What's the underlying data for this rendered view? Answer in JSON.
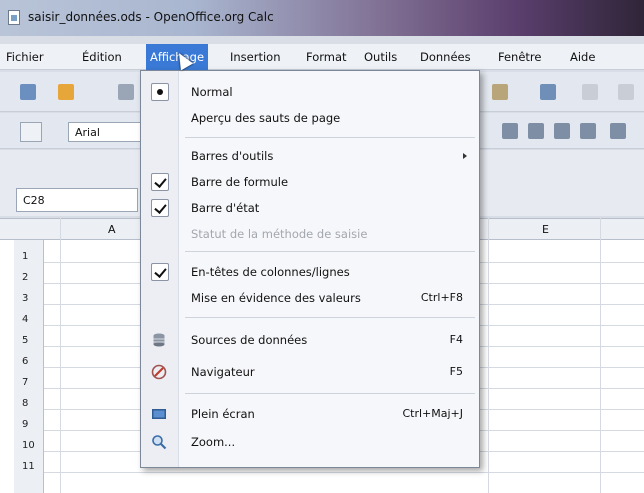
{
  "window": {
    "title": "saisir_données.ods - OpenOffice.org Calc"
  },
  "menubar": {
    "items": [
      {
        "label": "Fichier"
      },
      {
        "label": "Édition"
      },
      {
        "label": "Affichage"
      },
      {
        "label": "Insertion"
      },
      {
        "label": "Format"
      },
      {
        "label": "Outils"
      },
      {
        "label": "Données"
      },
      {
        "label": "Fenêtre"
      },
      {
        "label": "Aide"
      }
    ]
  },
  "toolbar": {
    "font_name": "Arial"
  },
  "formula": {
    "cell_ref": "C28"
  },
  "sheet": {
    "columns": [
      "A",
      "E"
    ],
    "rows": [
      "1",
      "2",
      "3",
      "4",
      "5",
      "6",
      "7",
      "8",
      "9",
      "10",
      "11"
    ]
  },
  "view_menu": {
    "items": [
      {
        "label": "Normal",
        "indicator": "radio-selected"
      },
      {
        "label": "Aperçu des sauts de page"
      },
      {
        "label": "Barres d'outils",
        "submenu": true
      },
      {
        "label": "Barre de formule",
        "indicator": "checked"
      },
      {
        "label": "Barre d'état",
        "indicator": "checked"
      },
      {
        "label": "Statut de la méthode de saisie",
        "disabled": true
      },
      {
        "label": "En-têtes de colonnes/lignes",
        "indicator": "checked"
      },
      {
        "label": "Mise en évidence des valeurs",
        "shortcut": "Ctrl+F8"
      },
      {
        "label": "Sources de données",
        "shortcut": "F4",
        "icon": "database-icon"
      },
      {
        "label": "Navigateur",
        "shortcut": "F5",
        "icon": "navigator-icon"
      },
      {
        "label": "Plein écran",
        "shortcut": "Ctrl+Maj+J",
        "icon": "fullscreen-icon"
      },
      {
        "label": "Zoom...",
        "icon": "zoom-icon"
      }
    ]
  }
}
